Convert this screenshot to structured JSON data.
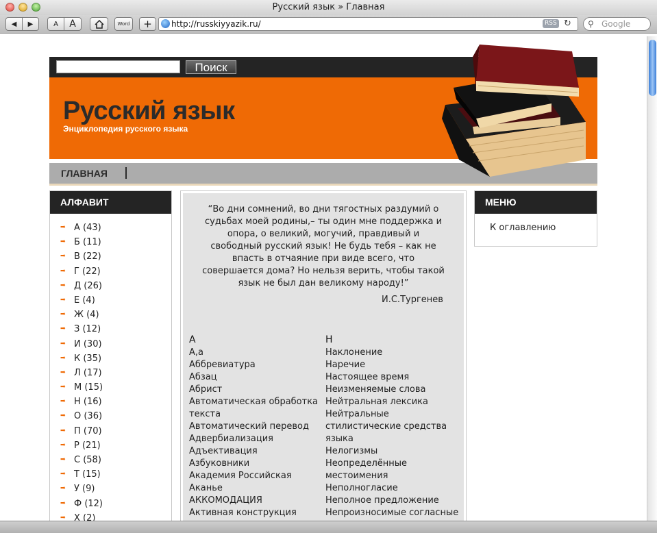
{
  "window": {
    "title": "Русский язык » Главная"
  },
  "toolbar": {
    "small_font_label": "A",
    "large_font_label": "A",
    "word_label": "Word",
    "add_label": "+",
    "address": "http://russkiyyazik.ru/",
    "rss_label": "RSS",
    "search_placeholder": "Google"
  },
  "site": {
    "search_button": "Поиск",
    "title": "Русский язык",
    "subtitle": "Энциклопедия русского языка",
    "nav": [
      "ГЛАВНАЯ"
    ]
  },
  "sidebar_left": {
    "title": "АЛФАВИТ",
    "items": [
      "А (43)",
      "Б (11)",
      "В (22)",
      "Г (22)",
      "Д (26)",
      "Е (4)",
      "Ж (4)",
      "З (12)",
      "И (30)",
      "К (35)",
      "Л (17)",
      "М (15)",
      "Н (16)",
      "О (36)",
      "П (70)",
      "Р (21)",
      "С (58)",
      "Т (15)",
      "У (9)",
      "Ф (12)",
      "Х (2)"
    ]
  },
  "content": {
    "quote_lines": [
      "“Во дни сомнений, во дни тягостных раздумий о",
      "судьбах моей родины,– ты один мне поддержка и",
      "опора, о великий, могучий, правдивый и",
      "свободный русский язык! Не будь тебя – как не",
      "впасть в отчаяние при виде всего, что",
      "совершается дома? Но нельзя верить, чтобы такой",
      "язык не был дан великому народу!”"
    ],
    "quote_author": "И.С.Тургенев",
    "col_a": {
      "letter": "А",
      "items": [
        "А,а",
        "Аббревиатура",
        "Абзац",
        "Абрист",
        "Автоматическая обработка",
        "текста",
        "Автоматический перевод",
        "Адвербиализация",
        "Адъективация",
        "Азбуковники",
        "Академия Российская",
        "Аканье",
        "АККОМОДАЦИЯ",
        "Активная конструкция"
      ]
    },
    "col_n": {
      "letter": "Н",
      "items": [
        "Наклонение",
        "Наречие",
        "Настоящее время",
        "Неизменяемые слова",
        "Нейтральная лексика",
        "Нейтральные",
        "стилистические средства",
        "языка",
        "Нелогизмы",
        "Неопределённые",
        "местоимения",
        "Неполногласие",
        "Неполное предложение",
        "Непроизносимые согласные"
      ]
    }
  },
  "sidebar_right": {
    "title": "МЕНЮ",
    "items": [
      "К оглавлению"
    ]
  },
  "colors": {
    "accent": "#ef6a05",
    "dark": "#242424",
    "nav": "#acacac"
  }
}
